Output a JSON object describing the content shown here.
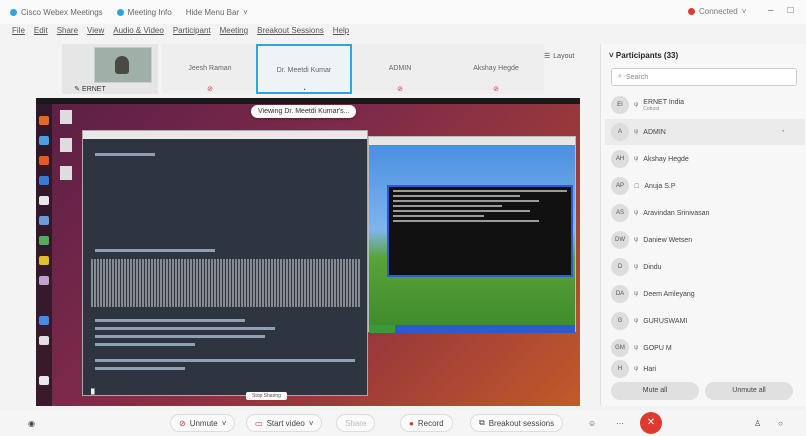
{
  "titlebar": {
    "app": "Cisco Webex Meetings",
    "meeting_info": "Meeting Info",
    "hide_menu": "Hide Menu Bar",
    "status": "Connected",
    "status_color": "#e0392f"
  },
  "menubar": [
    "File",
    "Edit",
    "Share",
    "View",
    "Audio & Video",
    "Participant",
    "Meeting",
    "Breakout Sessions",
    "Help"
  ],
  "strip": {
    "video_label": "ERNET",
    "names": [
      "Jeesh Raman",
      "Dr. Meetdi Kumar",
      "ADMIN",
      "Akshay Hegde"
    ],
    "layout": "Layout"
  },
  "share": {
    "viewing": "Viewing Dr. Meetdi Kumar's...",
    "note": "Stop Sharing"
  },
  "panel": {
    "title": "Participants (33)",
    "search_placeholder": "Search",
    "participants": [
      {
        "initials": "EI",
        "name": "ERNET India",
        "sub": "Cohost"
      },
      {
        "initials": "A",
        "name": "ADMIN",
        "sub": ""
      },
      {
        "initials": "AH",
        "name": "Akshay Hegde",
        "sub": ""
      },
      {
        "initials": "AP",
        "name": "Anuja S.P",
        "sub": ""
      },
      {
        "initials": "AS",
        "name": "Aravindan Srinivasan",
        "sub": ""
      },
      {
        "initials": "DW",
        "name": "Daniew Wetsen",
        "sub": ""
      },
      {
        "initials": "D",
        "name": "Dindu",
        "sub": ""
      },
      {
        "initials": "DA",
        "name": "Deem Amleyang",
        "sub": ""
      },
      {
        "initials": "G",
        "name": "GURUSWAMI",
        "sub": ""
      },
      {
        "initials": "GM",
        "name": "GOPU M",
        "sub": ""
      },
      {
        "initials": "H",
        "name": "Hari",
        "sub": ""
      }
    ],
    "mute_all": "Mute all",
    "unmute_all": "Unmute all"
  },
  "controls": {
    "unmute": "Unmute",
    "start_video": "Start video",
    "share": "Share",
    "record": "Record",
    "breakout": "Breakout sessions"
  }
}
